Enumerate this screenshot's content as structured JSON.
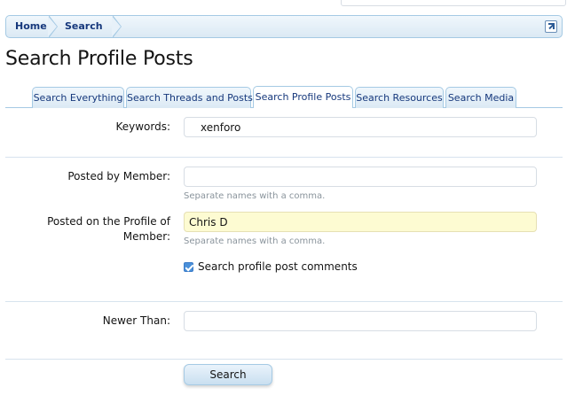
{
  "breadcrumb": {
    "home": "Home",
    "search": "Search"
  },
  "page": {
    "title": "Search Profile Posts"
  },
  "tabs": [
    {
      "label": "Search Everything",
      "active": false
    },
    {
      "label": "Search Threads and Posts",
      "active": false
    },
    {
      "label": "Search Profile Posts",
      "active": true
    },
    {
      "label": "Search Resources",
      "active": false
    },
    {
      "label": "Search Media",
      "active": false
    }
  ],
  "form": {
    "keywords_label": "Keywords:",
    "keywords_value": "xenforo",
    "posted_by_label": "Posted by Member:",
    "posted_by_value": "",
    "posted_by_hint": "Separate names with a comma.",
    "profile_label_line1": "Posted on the Profile of",
    "profile_label_line2": "Member:",
    "profile_value": "Chris D",
    "profile_hint": "Separate names with a comma.",
    "comments_checkbox_label": "Search profile post comments",
    "comments_checked": true,
    "newer_than_label": "Newer Than:",
    "newer_than_value": "",
    "submit_label": "Search"
  },
  "colors": {
    "link": "#16387c",
    "border": "#a5cae4",
    "highlight_input": "#fdfbd2"
  }
}
